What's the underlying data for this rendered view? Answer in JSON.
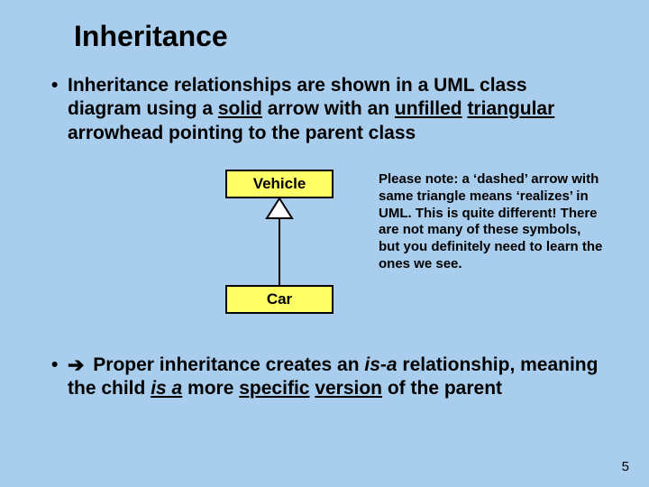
{
  "title": "Inheritance",
  "bullet1": {
    "pre": "Inheritance relationships are shown in a UML class diagram using a ",
    "u1": "solid",
    "mid1": " arrow with an ",
    "u2": "unfilled",
    "sp": " ",
    "u3": "triangular",
    "post": " arrowhead pointing to the parent class"
  },
  "diagram": {
    "parent": "Vehicle",
    "child": "Car"
  },
  "note": "Please note:  a ‘dashed’ arrow with same triangle means ‘realizes’ in UML.  This is quite different!  There are not many of these symbols, but you definitely need to learn the ones we see.",
  "bullet2": {
    "arrow": "➔",
    "pre": " Proper inheritance creates an ",
    "i1": "is-a",
    "mid1": " relationship, meaning the child ",
    "u_i": "is a",
    "mid2": " more ",
    "u1": "specific",
    "sp": " ",
    "u2": "version",
    "post": " of the parent"
  },
  "page": "5"
}
